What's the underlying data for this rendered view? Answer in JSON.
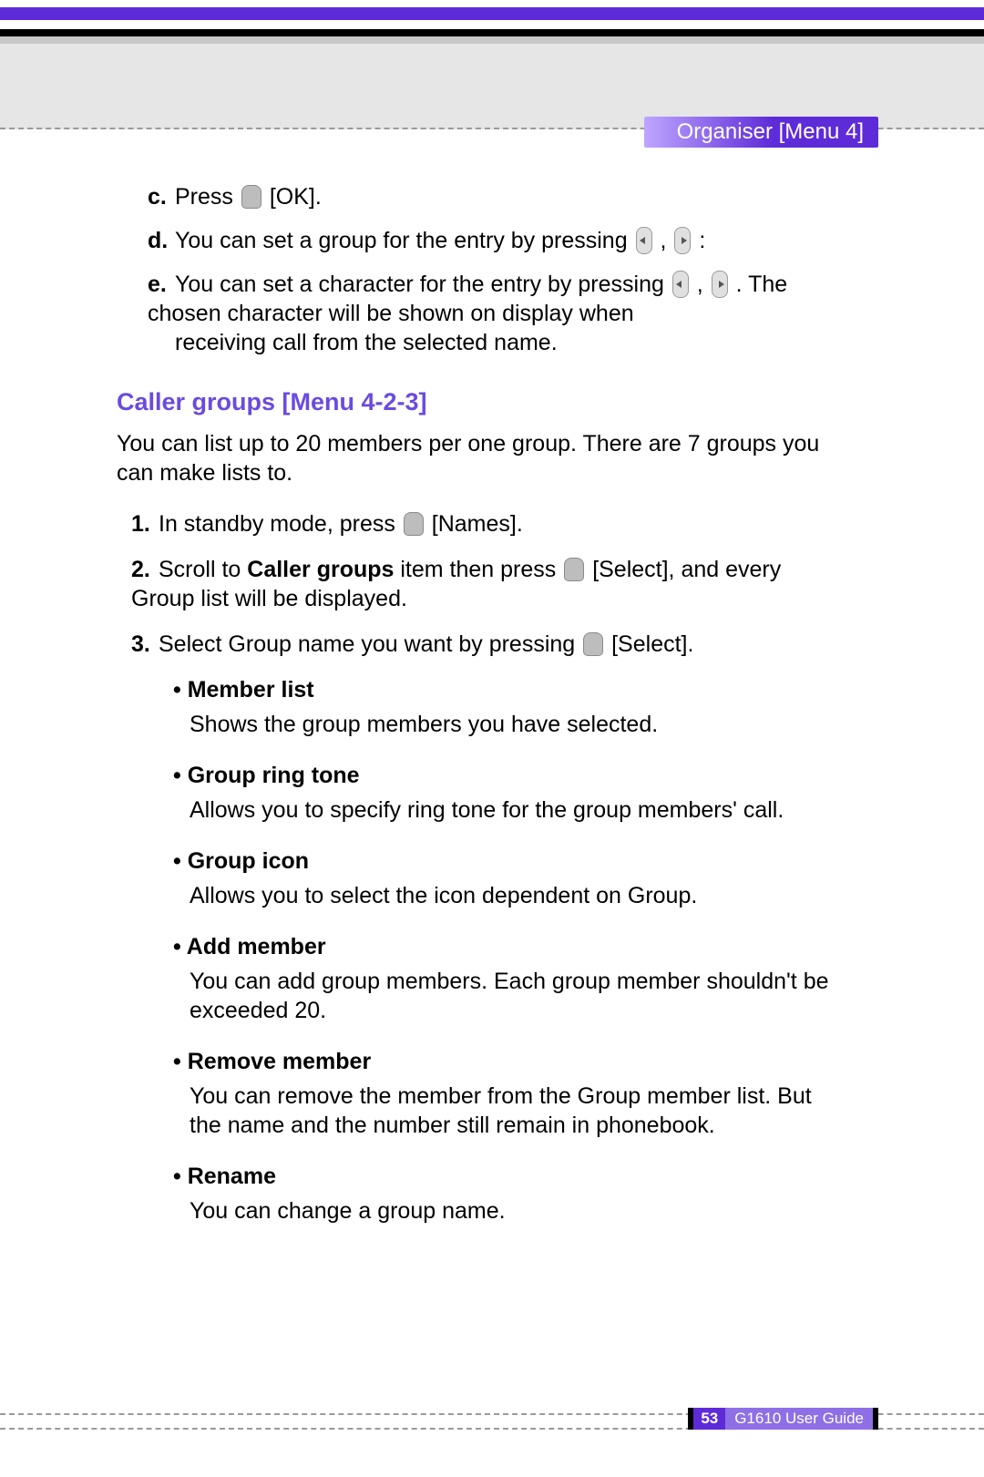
{
  "header": {
    "chapter_tab": "Organiser [Menu 4]"
  },
  "steps_letters": {
    "c": {
      "marker": "c.",
      "text_pre": "Press",
      "text_post": "[OK]."
    },
    "d": {
      "marker": "d.",
      "text_pre": "You can set a group for the entry by pressing",
      "text_post": ":"
    },
    "e": {
      "marker": "e.",
      "text_pre": "You can set a character for the entry by pressing",
      "text_mid": ". The chosen character will be shown on display when",
      "text_post": "receiving call from the selected name."
    }
  },
  "section": {
    "heading": "Caller groups [Menu 4-2-3]",
    "intro": "You can list up to 20 members per one group. There are 7 groups you can make lists to."
  },
  "steps_numbers": {
    "s1": {
      "marker": "1.",
      "pre": "In standby mode, press",
      "post": "[Names]."
    },
    "s2": {
      "marker": "2.",
      "pre": "Scroll to ",
      "bold": "Caller groups",
      "mid": " item then press",
      "post": "[Select], and every Group list will be displayed."
    },
    "s3": {
      "marker": "3.",
      "pre": "Select Group name you want by pressing",
      "post": "[Select]."
    }
  },
  "bullets": [
    {
      "title": "Member list",
      "body": "Shows the group members you have selected."
    },
    {
      "title": "Group ring tone",
      "body": "Allows you to specify ring tone for the group members' call."
    },
    {
      "title": "Group icon",
      "body": "Allows you to select the icon dependent on Group."
    },
    {
      "title": "Add member",
      "body": "You can add group members. Each group member shouldn't be exceeded 20."
    },
    {
      "title": "Remove member",
      "body": "You can remove the member from the Group member list. But the name and the number still remain in phonebook."
    },
    {
      "title": "Rename",
      "body": "You can change a group name."
    }
  ],
  "footer": {
    "page_number": "53",
    "guide_title": "G1610 User Guide"
  }
}
